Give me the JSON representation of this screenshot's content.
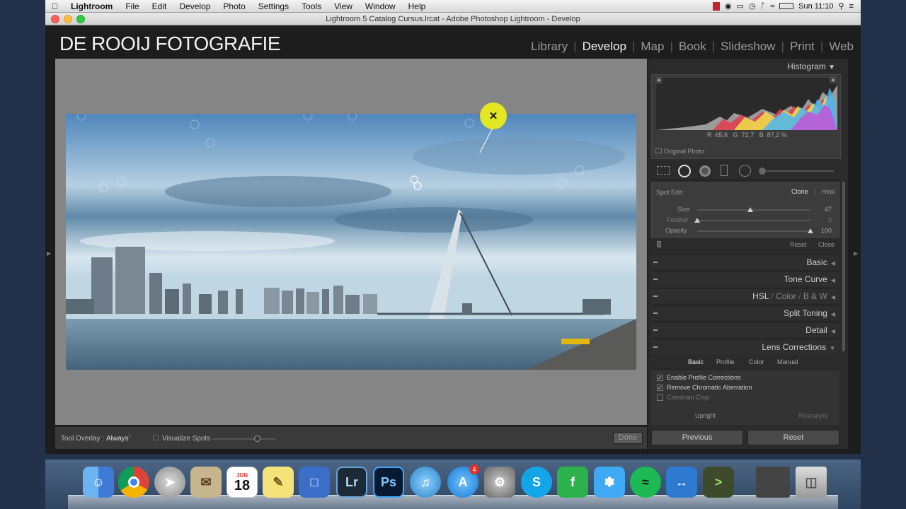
{
  "menubar": {
    "items": [
      "Lightroom",
      "File",
      "Edit",
      "Develop",
      "Photo",
      "Settings",
      "Tools",
      "View",
      "Window",
      "Help"
    ],
    "clock": "Sun 11:10"
  },
  "window": {
    "title": "Lightroom 5 Catalog Cursus.lrcat - Adobe Photoshop Lightroom - Develop"
  },
  "identity_plate": "DE ROOIJ FOTOGRAFIE",
  "modules": [
    "Library",
    "Develop",
    "Map",
    "Book",
    "Slideshow",
    "Print",
    "Web"
  ],
  "active_module": "Develop",
  "toolbar": {
    "overlay_label": "Tool Overlay :",
    "overlay_value": "Always",
    "visualize_label": "Visualize Spots",
    "visualize_level": 0.7,
    "done": "Done"
  },
  "histogram": {
    "title": "Histogram",
    "r_label": "R",
    "r_value": "65,6",
    "g_label": "G",
    "g_value": "72,7",
    "b_label": "B",
    "b_value": "87,2",
    "pct": "%",
    "original_photo": "Original Photo"
  },
  "spot_edit": {
    "label": "Spot Edit :",
    "clone": "Clone",
    "heal": "Heal",
    "sliders": [
      {
        "name": "Size",
        "value": "47",
        "level": 0.47
      },
      {
        "name": "Feather",
        "value": "0",
        "level": 0.0
      },
      {
        "name": "Opacity",
        "value": "100",
        "level": 1.0
      }
    ],
    "reset": "Reset",
    "close": "Close"
  },
  "panels": [
    "Basic",
    "Tone Curve",
    "Split Toning",
    "Detail",
    "Lens Corrections"
  ],
  "hsl": {
    "hsl": "HSL",
    "color": "Color",
    "bw": "B & W"
  },
  "lens": {
    "tabs": [
      "Basic",
      "Profile",
      "Color",
      "Manual"
    ],
    "options": [
      {
        "label": "Enable Profile Corrections",
        "checked": true
      },
      {
        "label": "Remove Chromatic Aberration",
        "checked": true
      },
      {
        "label": "Constrain Crop",
        "checked": false
      }
    ],
    "upright": "Upright",
    "reanalyze": "Reanalyze"
  },
  "buttons": {
    "previous": "Previous",
    "reset": "Reset"
  },
  "dock": {
    "items": [
      "Finder",
      "Chrome",
      "Launchpad",
      "Mail",
      "Calendar",
      "Notes",
      "Keynote",
      "Lightroom",
      "Photoshop",
      "iTunes",
      "App Store",
      "System Preferences",
      "Skype",
      "Feedly",
      "Twitter",
      "Spotify",
      "TeamViewer",
      "Terminal",
      "Trash"
    ],
    "calendar_month": "JUN",
    "calendar_day": "18",
    "lr": "Lr",
    "ps": "Ps",
    "appstore_badge": "4"
  }
}
